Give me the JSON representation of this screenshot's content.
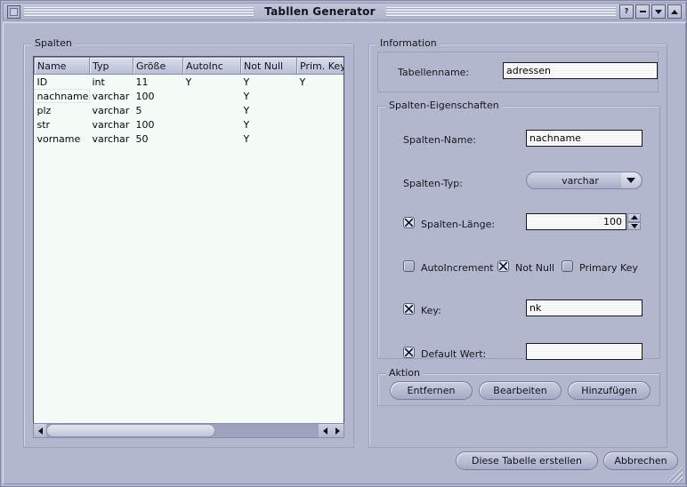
{
  "window": {
    "title": "Tabllen Generator",
    "sys_menu_icon": "window-menu-icon",
    "buttons": [
      {
        "name": "help-button",
        "glyph": "?"
      },
      {
        "name": "minimize-button",
        "glyph": "-"
      },
      {
        "name": "restore-down-button",
        "glyph": "v"
      },
      {
        "name": "maximize-button",
        "glyph": "^"
      }
    ]
  },
  "columns_panel": {
    "legend": "Spalten",
    "table": {
      "headers": [
        "Name",
        "Typ",
        "Größe",
        "AutoInc",
        "Not Null",
        "Prim. Key"
      ],
      "rows": [
        {
          "name": "ID",
          "typ": "int",
          "groesse": "11",
          "autoinc": "Y",
          "notnull": "Y",
          "primkey": "Y",
          "selected": false
        },
        {
          "name": "nachname",
          "typ": "varchar",
          "groesse": "100",
          "autoinc": "",
          "notnull": "Y",
          "primkey": "",
          "selected": true
        },
        {
          "name": "plz",
          "typ": "varchar",
          "groesse": "5",
          "autoinc": "",
          "notnull": "Y",
          "primkey": "",
          "selected": false
        },
        {
          "name": "str",
          "typ": "varchar",
          "groesse": "100",
          "autoinc": "",
          "notnull": "Y",
          "primkey": "",
          "selected": false
        },
        {
          "name": "vorname",
          "typ": "varchar",
          "groesse": "50",
          "autoinc": "",
          "notnull": "Y",
          "primkey": "",
          "selected": false
        }
      ]
    },
    "scrollbar": {
      "left_arrow": "left-arrow-icon",
      "right_arrow": "right-arrow-icon",
      "thumb_ratio": "62%"
    }
  },
  "information_panel": {
    "legend": "Information",
    "table_name_label": "Tabellenname:",
    "table_name_value": "adressen",
    "column_props": {
      "legend": "Spalten-Eigenschaften",
      "column_name_label": "Spalten-Name:",
      "column_name_value": "nachname",
      "column_type_label": "Spalten-Typ:",
      "column_type_value": "varchar",
      "column_length_label": "Spalten-Länge:",
      "column_length_value": "100",
      "column_length_checked": true,
      "autoincrement_label": "AutoIncrement",
      "autoincrement_checked": false,
      "notnull_label": "Not Null",
      "notnull_checked": true,
      "primarykey_label": "Primary Key",
      "primarykey_checked": false,
      "key_label": "Key:",
      "key_value": "nk",
      "key_checked": true,
      "default_label": "Default Wert:",
      "default_value": "",
      "default_checked": true
    },
    "action": {
      "legend": "Aktion",
      "remove_label": "Entfernen",
      "edit_label": "Bearbeiten",
      "add_label": "Hinzufügen"
    }
  },
  "footer": {
    "create_label": "Diese Tabelle erstellen",
    "cancel_label": "Abbrechen"
  },
  "colors": {
    "background": "#b3b7cd",
    "selection": "#3a6b83",
    "field_background": "#fbfbfb",
    "table_background": "#f4fbf6"
  }
}
